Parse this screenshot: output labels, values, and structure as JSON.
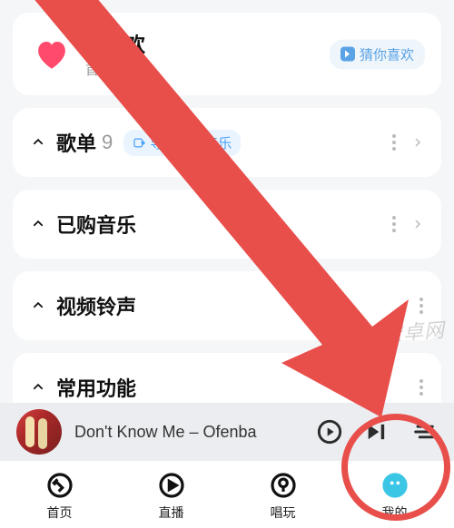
{
  "like_card": {
    "title": "我喜欢",
    "sub": "首",
    "guess_label": "猜你喜欢"
  },
  "rows": {
    "playlist": {
      "label": "歌单",
      "count": "9",
      "import_label": "导入外部音乐"
    },
    "purchased": {
      "label": "已购音乐"
    },
    "video_ring": {
      "label": "视频铃声"
    },
    "tools": {
      "label": "常用功能"
    }
  },
  "player": {
    "track": "Don't Know Me – Ofenba"
  },
  "nav": {
    "home": "首页",
    "live": "直播",
    "changwan": "唱玩",
    "mine": "我的"
  },
  "watermark": "冰糖安卓网",
  "colors": {
    "accent_red": "#e84f4b",
    "link_blue": "#4aa0ff",
    "active_cyan": "#3cc6e6"
  }
}
